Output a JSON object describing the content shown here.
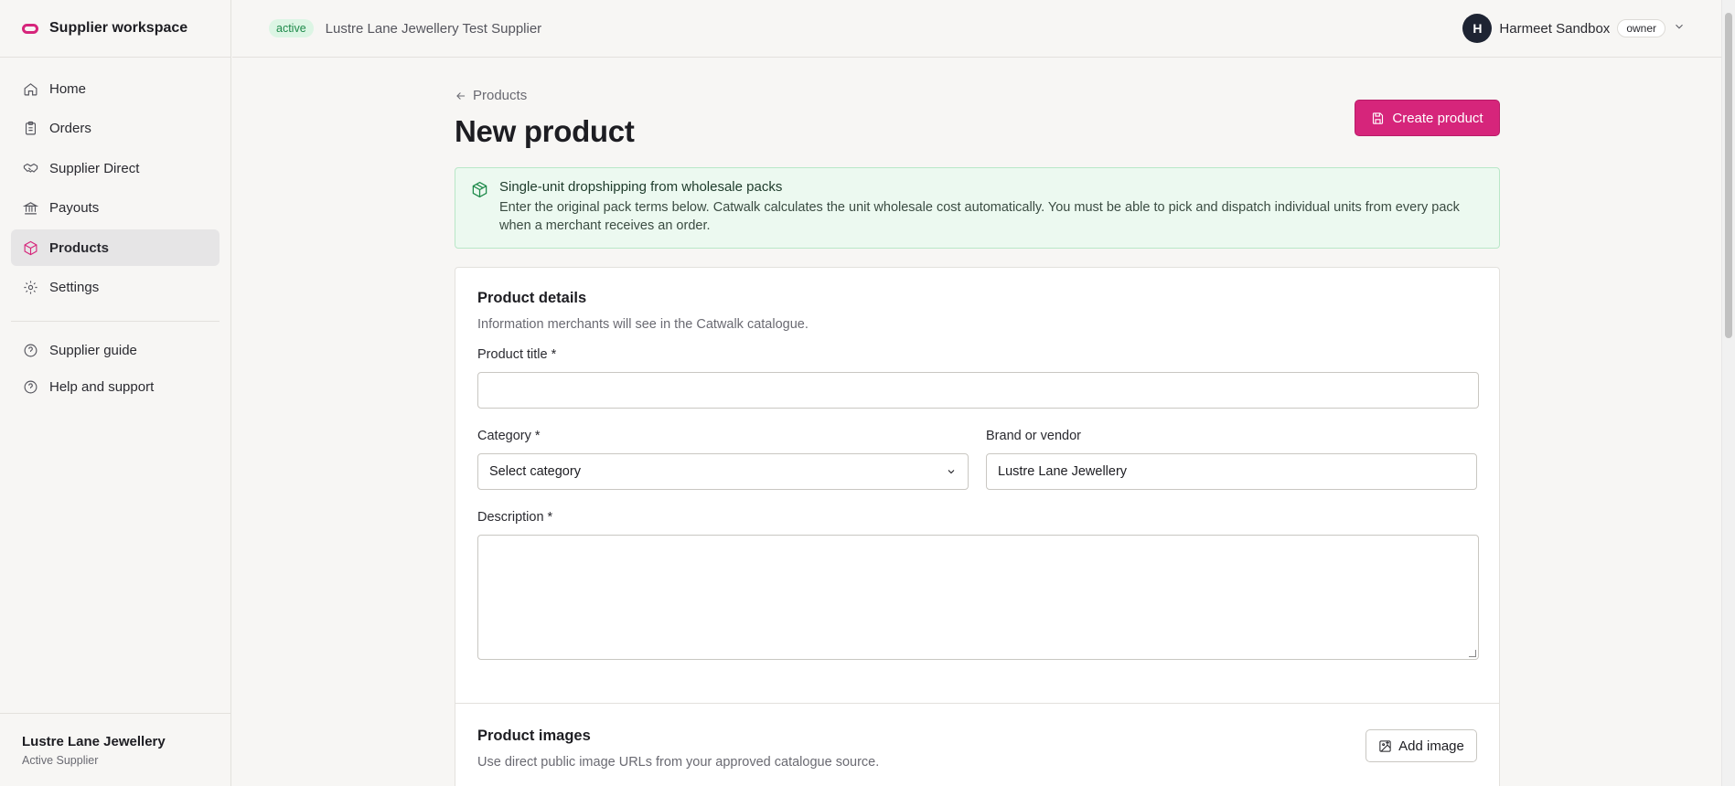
{
  "brand": {
    "name": "Supplier workspace",
    "logo_icon": "catwalk-logo-icon",
    "accent": "#d6257b"
  },
  "sidebar": {
    "items": [
      {
        "label": "Home",
        "icon": "home-icon"
      },
      {
        "label": "Orders",
        "icon": "clipboard-icon"
      },
      {
        "label": "Supplier Direct",
        "icon": "handshake-icon"
      },
      {
        "label": "Payouts",
        "icon": "bank-icon"
      },
      {
        "label": "Products",
        "icon": "box-icon",
        "active": true
      },
      {
        "label": "Settings",
        "icon": "gear-icon"
      }
    ],
    "secondary": [
      {
        "label": "Supplier guide",
        "icon": "help-circle-icon"
      },
      {
        "label": "Help and support",
        "icon": "help-circle-icon"
      }
    ],
    "footer": {
      "name": "Lustre Lane Jewellery",
      "status": "Active Supplier"
    }
  },
  "topbar": {
    "status_badge": "active",
    "supplier_name": "Lustre Lane Jewellery Test Supplier",
    "user": {
      "initial": "H",
      "name": "Harmeet Sandbox",
      "role": "owner"
    }
  },
  "page": {
    "back_link": "Products",
    "title": "New product",
    "create_button": "Create product"
  },
  "notice": {
    "title": "Single-unit dropshipping from wholesale packs",
    "body": "Enter the original pack terms below. Catwalk calculates the unit wholesale cost automatically. You must be able to pick and dispatch individual units from every pack when a merchant receives an order."
  },
  "product_details": {
    "title": "Product details",
    "subtitle": "Information merchants will see in the Catwalk catalogue.",
    "fields": {
      "title_label": "Product title *",
      "title_value": "",
      "category_label": "Category *",
      "category_value": "Select category",
      "brand_label": "Brand or vendor",
      "brand_value": "Lustre Lane Jewellery",
      "description_label": "Description *",
      "description_value": ""
    }
  },
  "product_images": {
    "title": "Product images",
    "subtitle": "Use direct public image URLs from your approved catalogue source.",
    "add_button": "Add image"
  }
}
